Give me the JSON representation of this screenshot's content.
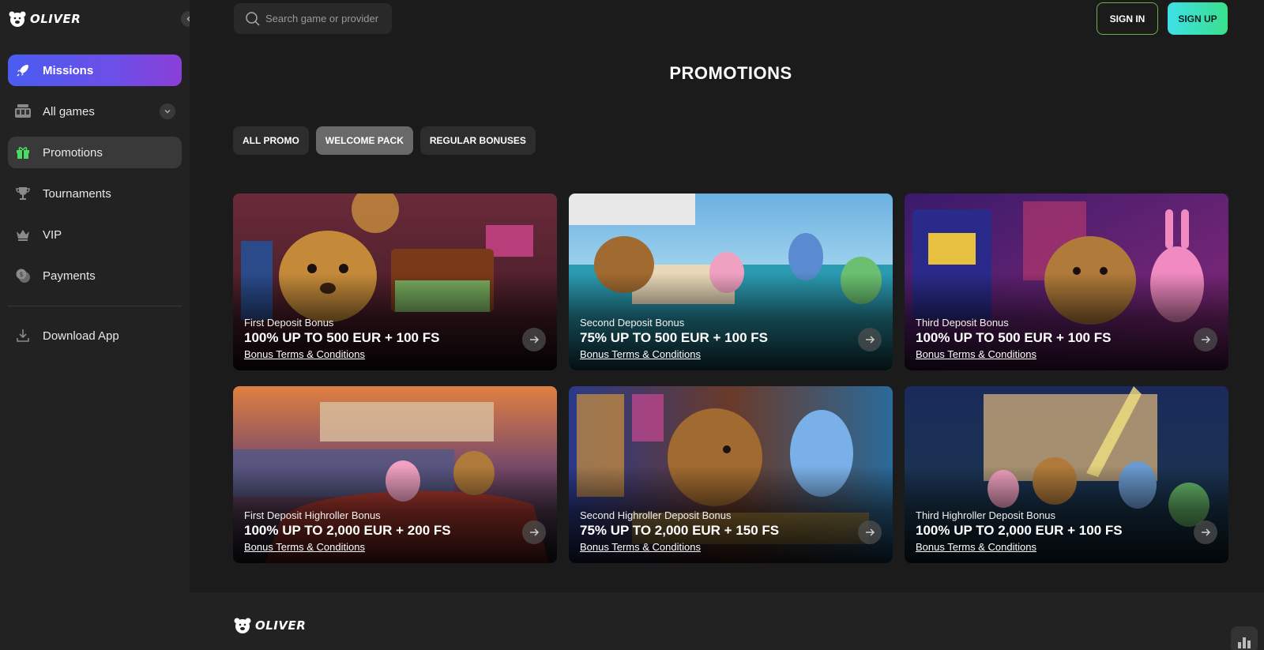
{
  "brand": {
    "name": "OLIVER"
  },
  "search": {
    "placeholder": "Search game or provider"
  },
  "auth": {
    "signin_label": "SIGN IN",
    "signup_label": "SIGN UP"
  },
  "sidebar": {
    "items": [
      {
        "label": "Missions",
        "icon": "rocket-icon"
      },
      {
        "label": "All games",
        "icon": "slot-machine-icon"
      },
      {
        "label": "Promotions",
        "icon": "gift-icon"
      },
      {
        "label": "Tournaments",
        "icon": "trophy-icon"
      },
      {
        "label": "VIP",
        "icon": "crown-icon"
      },
      {
        "label": "Payments",
        "icon": "coins-icon"
      }
    ],
    "download_label": "Download App"
  },
  "main": {
    "title": "PROMOTIONS",
    "tabs": [
      {
        "label": "ALL PROMO"
      },
      {
        "label": "WELCOME PACK",
        "active": true
      },
      {
        "label": "REGULAR BONUSES"
      }
    ],
    "cards": [
      {
        "subtitle": "First Deposit Bonus",
        "headline": "100% UP TO 500 EUR + 100 FS",
        "terms": "Bonus Terms & Conditions"
      },
      {
        "subtitle": "Second Deposit Bonus",
        "headline": "75% UP TO 500 EUR + 100 FS",
        "terms": "Bonus Terms & Conditions"
      },
      {
        "subtitle": "Third Deposit Bonus",
        "headline": "100% UP TO 500 EUR + 100 FS",
        "terms": "Bonus Terms & Conditions"
      },
      {
        "subtitle": "First Deposit Highroller Bonus",
        "headline": "100% UP TO 2,000 EUR + 200 FS",
        "terms": "Bonus Terms & Conditions"
      },
      {
        "subtitle": "Second Highroller Deposit Bonus",
        "headline": "75% UP TO 2,000 EUR + 150 FS",
        "terms": "Bonus Terms & Conditions"
      },
      {
        "subtitle": "Third Highroller Deposit Bonus",
        "headline": "100% UP TO 2,000 EUR + 100 FS",
        "terms": "Bonus Terms & Conditions"
      }
    ]
  },
  "colors": {
    "missions_gradient": [
      "#4a5cf0",
      "#8a3fd8"
    ],
    "signup_gradient": [
      "#3ee0e8",
      "#39e08a"
    ],
    "signin_border": "#6ab04c"
  }
}
